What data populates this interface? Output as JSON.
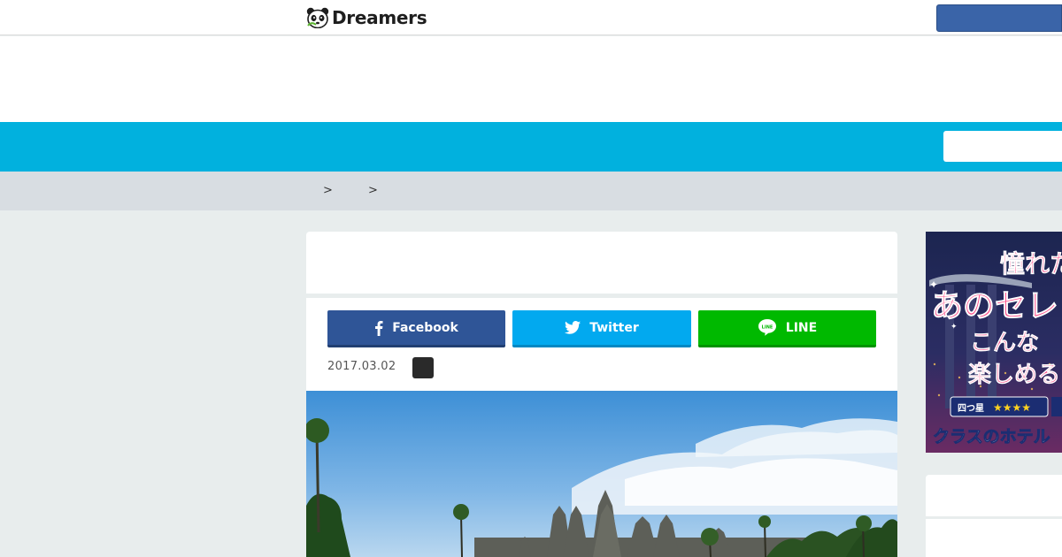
{
  "header": {
    "logo_text": "Dreamers",
    "logo_icon": "panda-icon"
  },
  "breadcrumb": {
    "separators": [
      ">",
      ">"
    ]
  },
  "share": {
    "facebook_label": "Facebook",
    "twitter_label": "Twitter",
    "line_label": "LINE",
    "line_icon_text": "LINE"
  },
  "article": {
    "date": "2017.03.02"
  },
  "sidebar": {
    "banner_lines": [
      "憧れた",
      "あのセレ",
      "こんな",
      "楽しめる"
    ],
    "banner_badge_label": "四つ星",
    "banner_badge_stars": "★★★★",
    "banner_bottom": "クラスのホテル"
  },
  "colors": {
    "brand_nav": "#01b1de",
    "facebook": "#2f5597",
    "twitter": "#02a9ef",
    "line": "#00b900"
  }
}
